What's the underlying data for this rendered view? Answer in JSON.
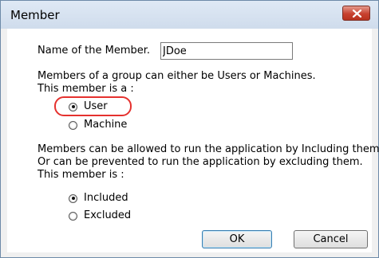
{
  "window": {
    "title": "Member",
    "close_icon": "close-icon"
  },
  "name_field": {
    "label": "Name of the Member.",
    "value": "JDoe"
  },
  "type_section": {
    "line1": "Members of a group can either be Users or Machines.",
    "line2": "This member is a :",
    "options": [
      {
        "label": "User",
        "checked": true
      },
      {
        "label": "Machine",
        "checked": false
      }
    ]
  },
  "include_section": {
    "line1": "Members can be allowed to run the application by Including them",
    "line2": "Or can be prevented to run the application by excluding them.",
    "line3": "This member is :",
    "options": [
      {
        "label": "Included",
        "checked": true
      },
      {
        "label": "Excluded",
        "checked": false
      }
    ]
  },
  "buttons": {
    "ok": "OK",
    "cancel": "Cancel"
  },
  "colors": {
    "highlight": "#e5312e",
    "close_button": "#c7412f"
  }
}
